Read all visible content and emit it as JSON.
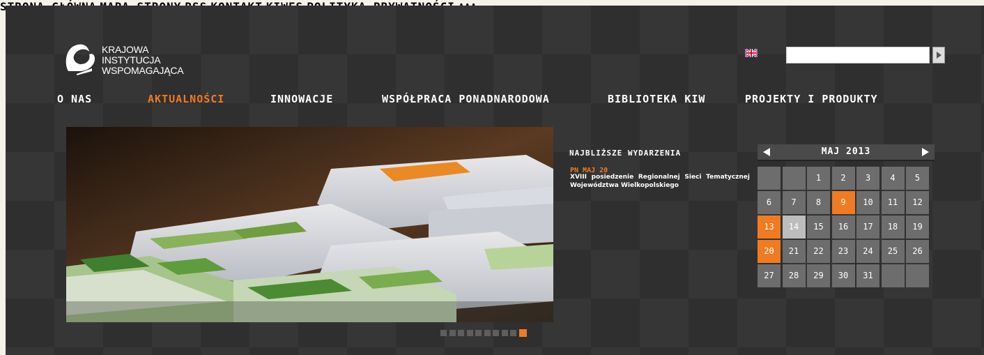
{
  "top_nav": [
    "STRONA GŁÓWNA",
    "MAPA STRONY",
    "RSS",
    "KONTAKT",
    "KIWFS",
    "POLITYKA PRYWATNOŚCI",
    "AAA"
  ],
  "logo": {
    "lines": [
      "KRAJOWA",
      "INSTYTUCJA",
      "WSPOMAGAJĄCA"
    ]
  },
  "search": {
    "value": "",
    "placeholder": ""
  },
  "main_nav": [
    {
      "label": "O NAS",
      "active": false
    },
    {
      "label": "AKTUALNOŚCI",
      "active": true
    },
    {
      "label": "INNOWACJE",
      "active": false
    },
    {
      "label": "WSPÓŁPRACA PONADNARODOWA",
      "active": false
    },
    {
      "label": "BIBLIOTEKA KIW",
      "active": false
    },
    {
      "label": "PROJEKTY I PRODUKTY",
      "active": false
    }
  ],
  "slider": {
    "count": 10,
    "active_index": 9
  },
  "events": {
    "title": "NAJBLIŻSZE WYDARZENIA",
    "items": [
      {
        "date": "PN MAJ 20",
        "line1": "XVIII posiedzenie Regionalnej Sieci Tematycznej",
        "line2": "Województwa Wielkopolskiego"
      }
    ]
  },
  "calendar": {
    "month_label": "MAJ 2013",
    "weeks": [
      [
        "",
        "",
        "1",
        "2",
        "3",
        "4",
        "5"
      ],
      [
        "6",
        "7",
        "8",
        "9",
        "10",
        "11",
        "12"
      ],
      [
        "13",
        "14",
        "15",
        "16",
        "17",
        "18",
        "19"
      ],
      [
        "20",
        "21",
        "22",
        "23",
        "24",
        "25",
        "26"
      ],
      [
        "27",
        "28",
        "29",
        "30",
        "31",
        "",
        ""
      ]
    ],
    "highlighted": [
      "9",
      "13",
      "20"
    ],
    "today": "14"
  },
  "colors": {
    "accent": "#f07b22",
    "background": "#2f2f2f",
    "cell": "#6d6d6d"
  }
}
